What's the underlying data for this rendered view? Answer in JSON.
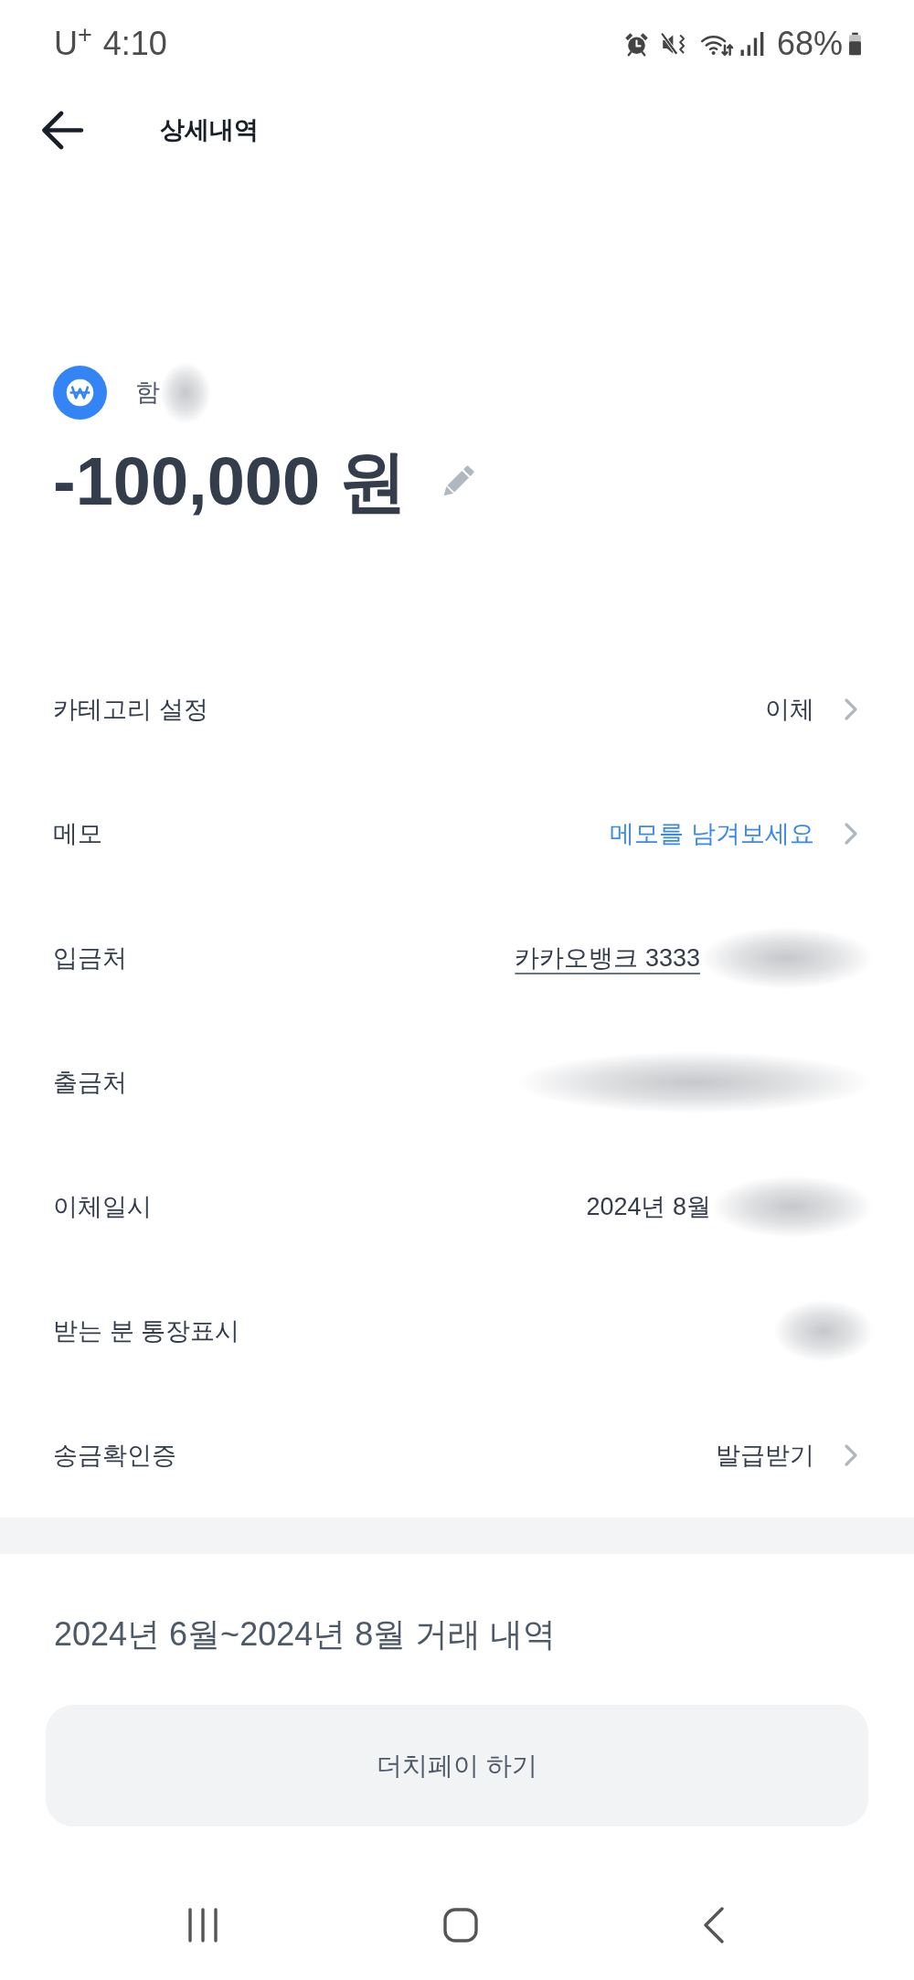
{
  "status_bar": {
    "carrier": "U$^{+}$",
    "time": "4:10",
    "battery": "68%"
  },
  "header": {
    "title": "상세내역"
  },
  "summary": {
    "payee": "함",
    "payee_blurred": true,
    "amount": "-100,000 원"
  },
  "rows": [
    {
      "label": "카테고리 설정",
      "kind": "text",
      "value": "이체",
      "blurred": false,
      "chevron": true
    },
    {
      "label": "메모",
      "kind": "prompt",
      "value": "메모를 남겨보세요",
      "blurred": false,
      "chevron": true
    },
    {
      "label": "입금처",
      "kind": "link",
      "value": "카카오뱅크 3333",
      "blurred": true,
      "chevron": false
    },
    {
      "label": "출금처",
      "kind": "text",
      "blurred": true,
      "chevron": false
    },
    {
      "label": "이체일시",
      "kind": "text",
      "value": "2024년 8월",
      "blurred": true,
      "chevron": false
    },
    {
      "label": "받는 분 통장표시",
      "kind": "text",
      "blurred": true,
      "chevron": false
    },
    {
      "label": "송금확인증",
      "kind": "text",
      "value": "발급받기",
      "blurred": false,
      "chevron": true
    }
  ],
  "history": {
    "title": "2024년 6월~2024년 8월 거래 내역"
  },
  "dutch_pay_button": {
    "label": "더치페이 하기"
  }
}
